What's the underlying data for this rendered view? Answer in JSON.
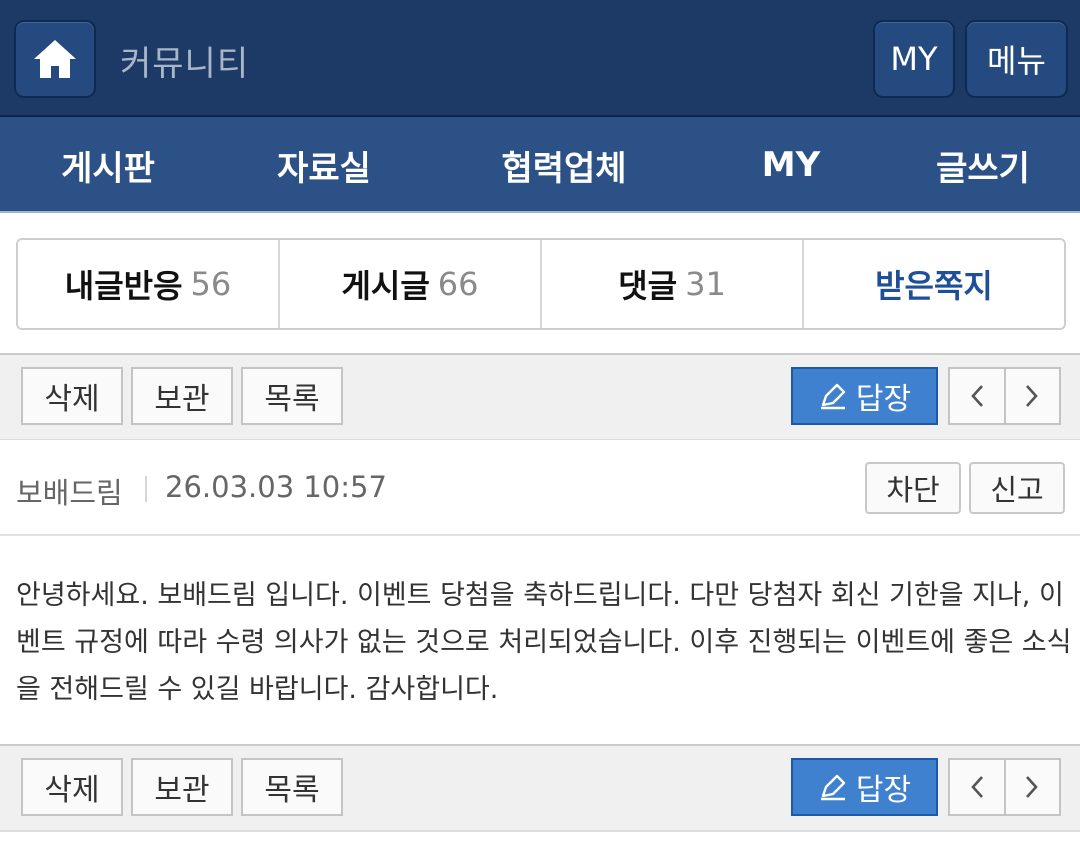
{
  "header": {
    "title": "커뮤니티",
    "my_label": "MY",
    "menu_label": "메뉴"
  },
  "nav": {
    "items": [
      "게시판",
      "자료실",
      "협력업체",
      "MY",
      "글쓰기"
    ]
  },
  "tabs": [
    {
      "label": "내글반응",
      "count": "56"
    },
    {
      "label": "게시글",
      "count": "66"
    },
    {
      "label": "댓글",
      "count": "31"
    },
    {
      "label": "받은쪽지",
      "count": ""
    }
  ],
  "toolbar": {
    "delete_label": "삭제",
    "archive_label": "보관",
    "list_label": "목록",
    "reply_label": "답장"
  },
  "message": {
    "author": "보배드림",
    "datetime": "26.03.03 10:57",
    "block_label": "차단",
    "report_label": "신고",
    "body": "안녕하세요. 보배드림 입니다. 이벤트 당첨을 축하드립니다. 다만 당첨자 회신 기한을 지나, 이벤트 규정에 따라 수령 의사가 없는 것으로 처리되었습니다. 이후 진행되는 이벤트에 좋은 소식을 전해드릴 수 있길 바랍니다. 감사합니다."
  },
  "colors": {
    "header_bg": "#1d3a66",
    "nav_bg": "#2b5186",
    "accent": "#3f80cf",
    "active_tab": "#1e4f98"
  },
  "icons": {
    "home": "home-icon",
    "reply": "pencil-icon",
    "prev": "chevron-left-icon",
    "next": "chevron-right-icon"
  }
}
